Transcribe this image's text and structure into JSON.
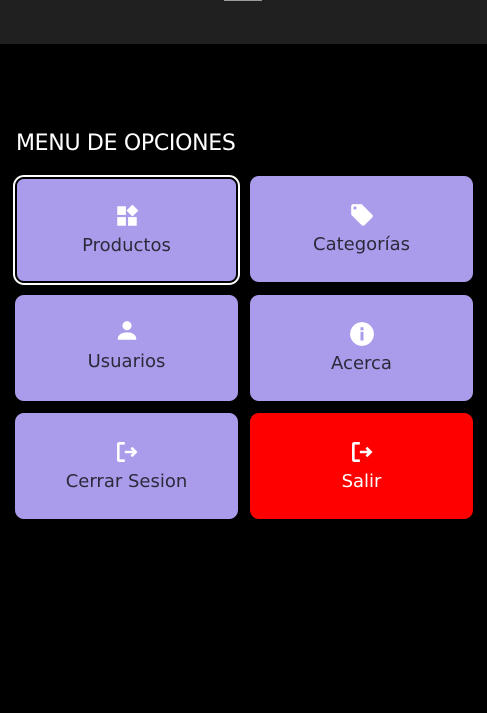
{
  "menu": {
    "title": "MENU DE OPCIONES"
  },
  "tiles": [
    {
      "label": "Productos",
      "icon": "widgets-icon",
      "color": "#ab9beb"
    },
    {
      "label": "Categorías",
      "icon": "tag-icon",
      "color": "#ab9beb"
    },
    {
      "label": "Usuarios",
      "icon": "person-icon",
      "color": "#ab9beb"
    },
    {
      "label": "Acerca",
      "icon": "info-icon",
      "color": "#ab9beb"
    },
    {
      "label": "Cerrar Sesion",
      "icon": "logout-icon",
      "color": "#ab9beb"
    },
    {
      "label": "Salir",
      "icon": "logout-icon",
      "color": "#ff0000"
    }
  ]
}
